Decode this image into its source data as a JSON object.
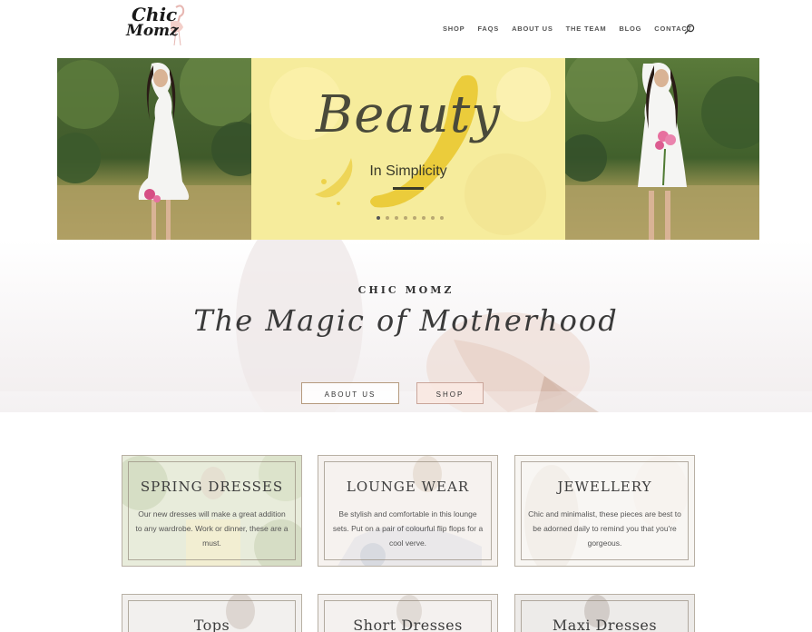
{
  "header": {
    "logo_line1": "Chic",
    "logo_line2": "Momz",
    "nav": [
      "SHOP",
      "FAQS",
      "ABOUT US",
      "THE TEAM",
      "BLOG",
      "CONTACT"
    ]
  },
  "hero": {
    "title": "Beauty",
    "subtitle": "In Simplicity",
    "slide_count": 8,
    "active_slide": 0
  },
  "intro": {
    "brand": "CHIC MOMZ",
    "tagline": "The Magic of Motherhood",
    "buttons": [
      "ABOUT US",
      "SHOP"
    ]
  },
  "categories": [
    {
      "title": "SPRING DRESSES",
      "desc": "Our new dresses will make a great addition to any wardrobe. Work or dinner, these are a must."
    },
    {
      "title": "LOUNGE WEAR",
      "desc": "Be stylish and comfortable in this lounge sets. Put on a pair of colourful flip flops for a cool verve."
    },
    {
      "title": "JEWELLERY",
      "desc": "Chic and minimalist, these pieces are best to be adorned daily to remind you that you're gorgeous."
    },
    {
      "title": "Tops",
      "desc": ""
    },
    {
      "title": "Short Dresses",
      "desc": ""
    },
    {
      "title": "Maxi Dresses",
      "desc": ""
    }
  ],
  "colors": {
    "accent_yellow": "#f6ec9c",
    "brush_gold": "#e9c72a",
    "button_border": "#b59a7e",
    "card_border": "#b8b0a4"
  }
}
